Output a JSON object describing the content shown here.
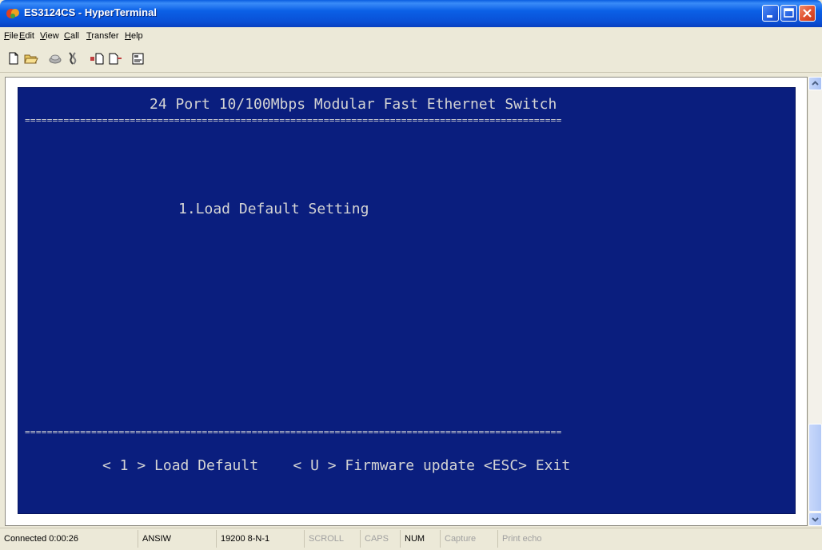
{
  "window": {
    "title": "ES3124CS - HyperTerminal"
  },
  "menu": [
    {
      "label": "File",
      "u": "F",
      "rest": "ile"
    },
    {
      "label": "Edit",
      "u": "E",
      "rest": "dit"
    },
    {
      "label": "View",
      "u": "V",
      "rest": "iew"
    },
    {
      "label": "Call",
      "u": "C",
      "rest": "all"
    },
    {
      "label": "Transfer",
      "u": "T",
      "rest": "ransfer"
    },
    {
      "label": "Help",
      "u": "H",
      "rest": "elp"
    }
  ],
  "toolbar": [
    "new-icon",
    "open-icon",
    "connect-icon",
    "disconnect-icon",
    "send-icon",
    "receive-icon",
    "properties-icon"
  ],
  "terminal": {
    "header": "24 Port 10/100Mbps Modular Fast Ethernet Switch",
    "separator": "=================================================================================================",
    "menu_option": "1.Load Default Setting",
    "footer": "< 1 > Load Default    < U > Firmware update <ESC> Exit"
  },
  "status": {
    "connected": "Connected 0:00:26",
    "emulation": "ANSIW",
    "port_settings": "19200 8-N-1",
    "scroll": "SCROLL",
    "caps": "CAPS",
    "num": "NUM",
    "capture": "Capture",
    "print_echo": "Print echo"
  },
  "colors": {
    "terminal_bg": "#0A1E7E",
    "terminal_fg": "#D4D4D4",
    "titlebar": "#0B60E6"
  }
}
